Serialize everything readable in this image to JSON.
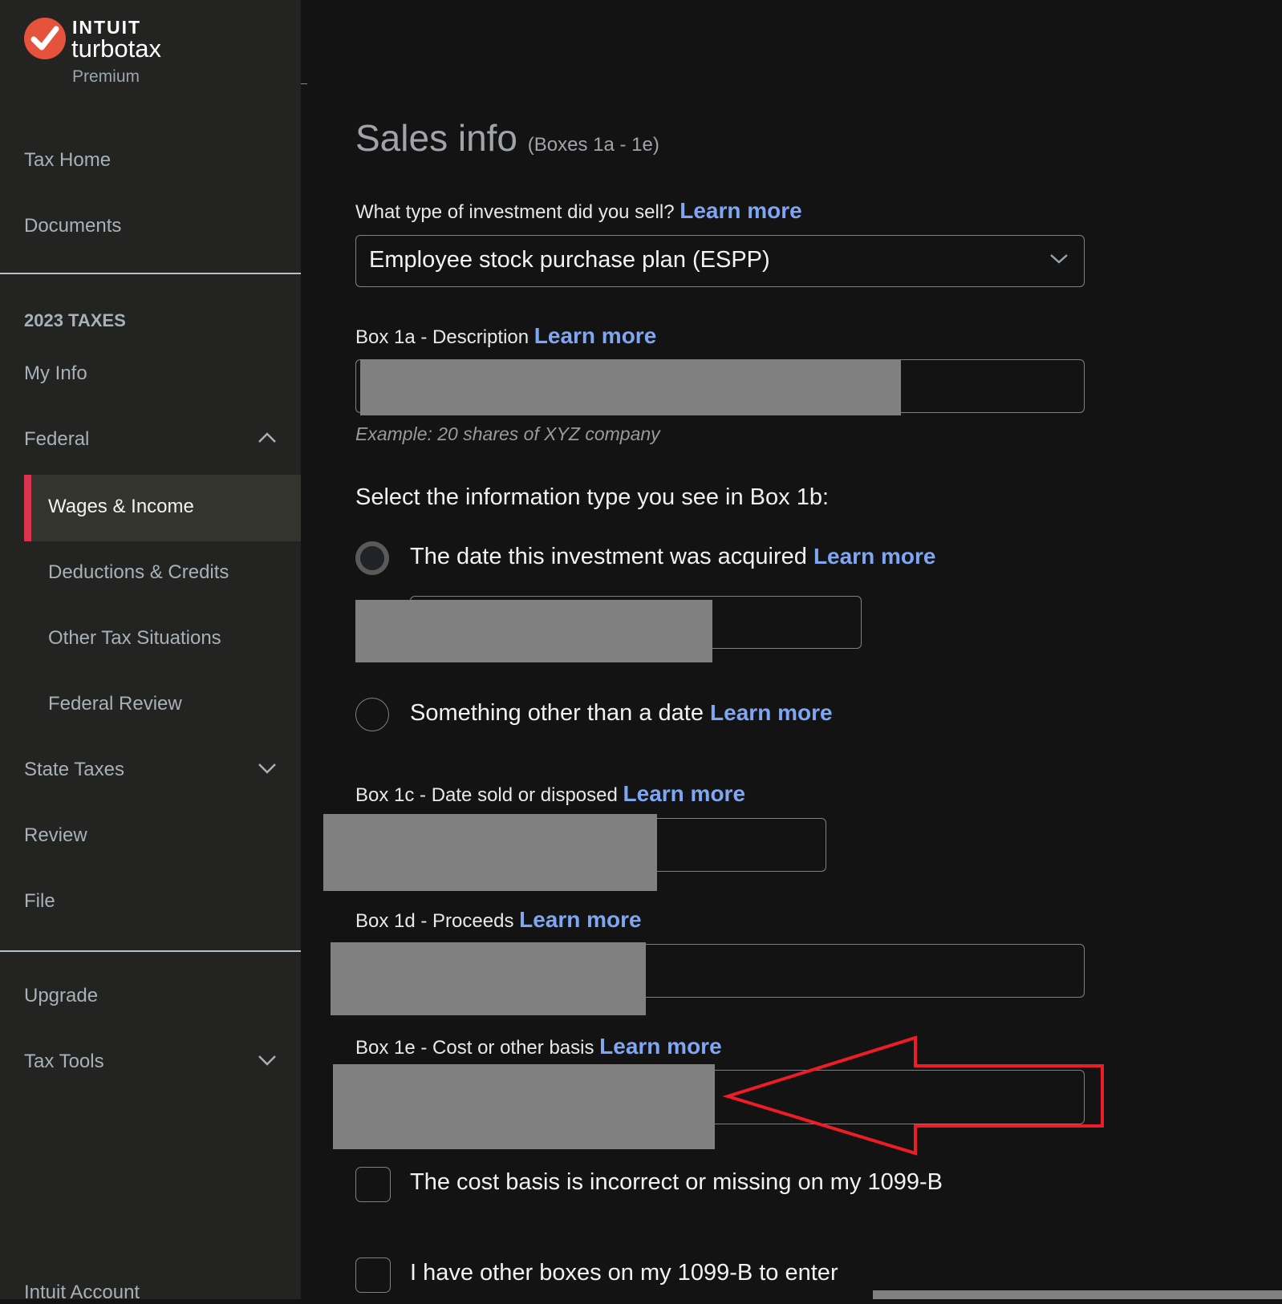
{
  "brand": {
    "company": "INTUIT",
    "product": "turbotax",
    "edition": "Premium",
    "badge_color": "#e5533d"
  },
  "sidebar": {
    "top_items": [
      {
        "label": "Tax Home"
      },
      {
        "label": "Documents"
      }
    ],
    "section_title": "2023 TAXES",
    "items": [
      {
        "label": "My Info"
      },
      {
        "label": "Federal",
        "expanded": true
      },
      {
        "label": "Wages & Income",
        "active": true
      },
      {
        "label": "Deductions & Credits"
      },
      {
        "label": "Other Tax Situations"
      },
      {
        "label": "Federal Review"
      },
      {
        "label": "State Taxes",
        "expanded": false
      },
      {
        "label": "Review"
      },
      {
        "label": "File"
      }
    ],
    "bottom_items": [
      {
        "label": "Upgrade"
      },
      {
        "label": "Tax Tools",
        "expanded": false
      },
      {
        "label": "Intuit Account"
      }
    ],
    "active_accent": "#d9334e"
  },
  "form": {
    "title": "Sales info",
    "title_suffix": "(Boxes 1a - 1e)",
    "learn_more": "Learn more",
    "investment_type": {
      "question": "What type of investment did you sell?",
      "selected": "Employee stock purchase plan (ESPP)"
    },
    "box1a": {
      "label": "Box 1a - Description",
      "value": "[redacted]",
      "hint": "Example: 20 shares of XYZ company"
    },
    "box1b": {
      "question": "Select the information type you see in Box 1b:",
      "options": [
        {
          "label": "The date this investment was acquired",
          "selected": true
        },
        {
          "label": "Something other than a date",
          "selected": false
        }
      ],
      "date_value": "[redacted]"
    },
    "box1c": {
      "label": "Box 1c - Date sold or disposed",
      "value": "[redacted]"
    },
    "box1d": {
      "label": "Box 1d - Proceeds",
      "value": "[redacted]"
    },
    "box1e": {
      "label": "Box 1e - Cost or other basis",
      "value": "[redacted]"
    },
    "checkboxes": [
      {
        "label": "The cost basis is incorrect or missing on my 1099-B",
        "checked": false
      },
      {
        "label": "I have other boxes on my 1099-B to enter",
        "checked": false
      }
    ],
    "link_color": "#7fa6f2",
    "annotation_color": "#ee1c25"
  }
}
